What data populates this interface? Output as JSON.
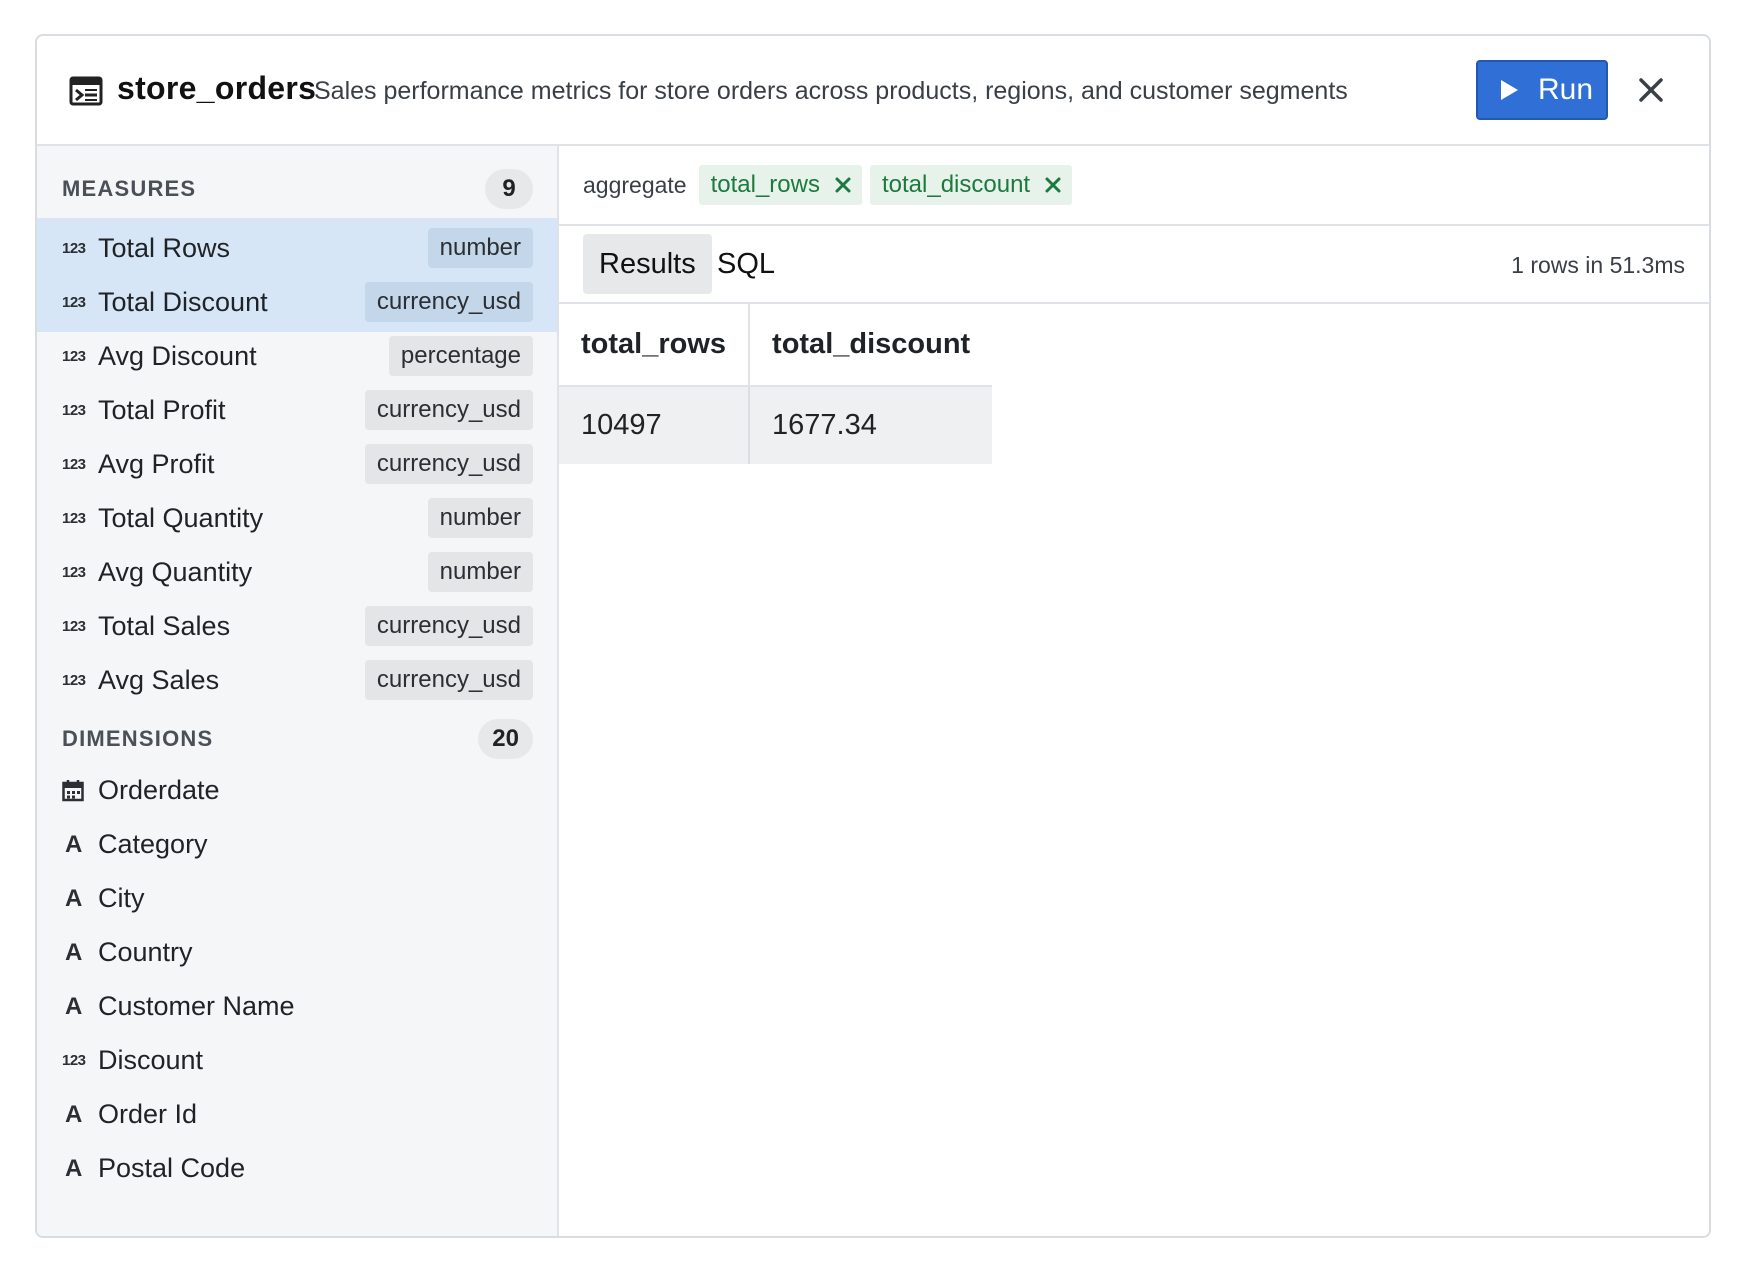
{
  "header": {
    "title": "store_orders",
    "description": "Sales performance metrics for store orders across products, regions, and customer segments",
    "run_label": "Run"
  },
  "measures": {
    "label": "MEASURES",
    "count": "9",
    "items": [
      {
        "icon": "123",
        "label": "Total Rows",
        "type": "number",
        "selected": true
      },
      {
        "icon": "123",
        "label": "Total Discount",
        "type": "currency_usd",
        "selected": true
      },
      {
        "icon": "123",
        "label": "Avg Discount",
        "type": "percentage",
        "selected": false
      },
      {
        "icon": "123",
        "label": "Total Profit",
        "type": "currency_usd",
        "selected": false
      },
      {
        "icon": "123",
        "label": "Avg Profit",
        "type": "currency_usd",
        "selected": false
      },
      {
        "icon": "123",
        "label": "Total Quantity",
        "type": "number",
        "selected": false
      },
      {
        "icon": "123",
        "label": "Avg Quantity",
        "type": "number",
        "selected": false
      },
      {
        "icon": "123",
        "label": "Total Sales",
        "type": "currency_usd",
        "selected": false
      },
      {
        "icon": "123",
        "label": "Avg Sales",
        "type": "currency_usd",
        "selected": false
      }
    ]
  },
  "dimensions": {
    "label": "DIMENSIONS",
    "count": "20",
    "items": [
      {
        "icon": "calendar",
        "label": "Orderdate"
      },
      {
        "icon": "A",
        "label": "Category"
      },
      {
        "icon": "A",
        "label": "City"
      },
      {
        "icon": "A",
        "label": "Country"
      },
      {
        "icon": "A",
        "label": "Customer Name"
      },
      {
        "icon": "123",
        "label": "Discount"
      },
      {
        "icon": "A",
        "label": "Order Id"
      },
      {
        "icon": "A",
        "label": "Postal Code"
      }
    ]
  },
  "query": {
    "aggregate_label": "aggregate",
    "chips": [
      "total_rows",
      "total_discount"
    ]
  },
  "tabs": {
    "results": "Results",
    "sql": "SQL"
  },
  "timing": "1 rows in 51.3ms",
  "results": {
    "columns": [
      "total_rows",
      "total_discount"
    ],
    "rows": [
      [
        "10497",
        "1677.34"
      ]
    ]
  },
  "colors": {
    "run_button": "#2f6fd6",
    "selected_row": "#d6e6f6",
    "chip_bg": "#e6f2ea",
    "chip_text": "#1c7a3e"
  }
}
